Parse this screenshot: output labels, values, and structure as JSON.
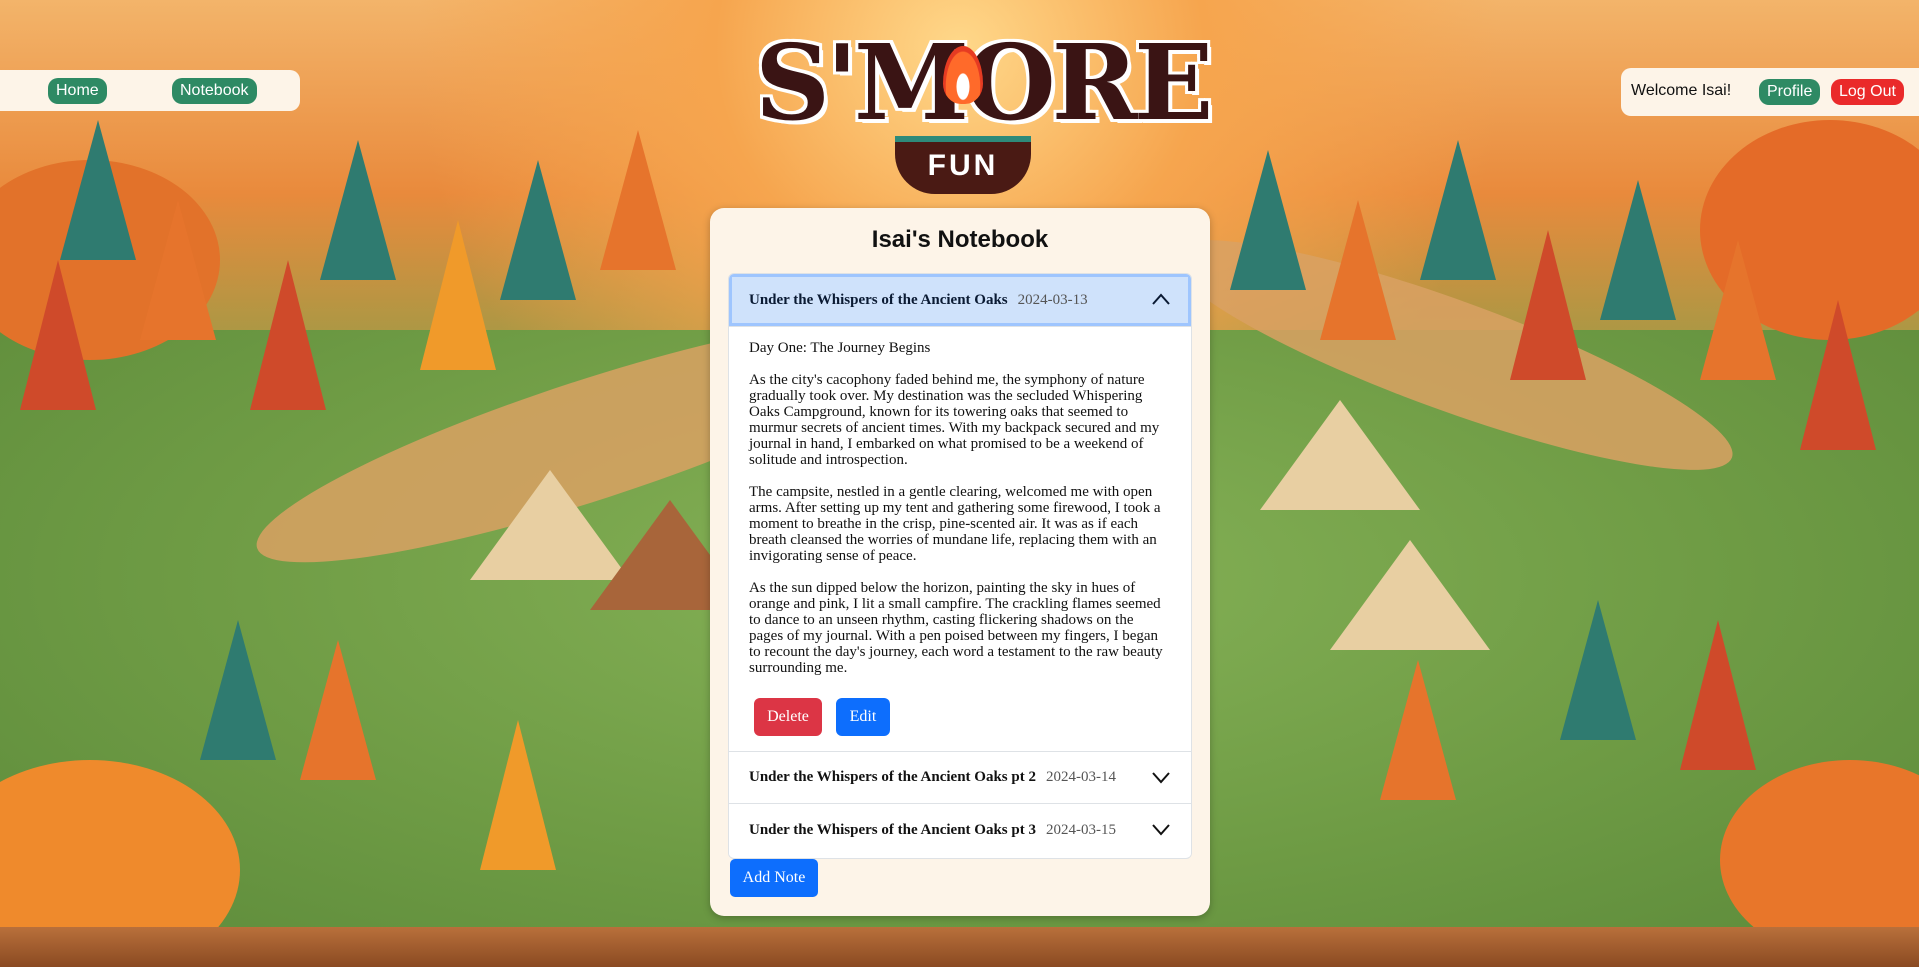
{
  "nav": {
    "home_label": "Home",
    "notebook_label": "Notebook",
    "welcome_text": "Welcome Isai!",
    "profile_label": "Profile",
    "logout_label": "Log Out"
  },
  "logo": {
    "main_text": "S'MORE",
    "sub_text": "FUN"
  },
  "notebook": {
    "title": "Isai's Notebook",
    "notes": [
      {
        "title": "Under the Whispers of the Ancient Oaks",
        "date": "2024-03-13",
        "expanded": true,
        "paragraphs": [
          "Day One: The Journey Begins",
          "As the city's cacophony faded behind me, the symphony of nature gradually took over. My destination was the secluded Whispering Oaks Campground, known for its towering oaks that seemed to murmur secrets of ancient times. With my backpack secured and my journal in hand, I embarked on what promised to be a weekend of solitude and introspection.",
          "The campsite, nestled in a gentle clearing, welcomed me with open arms. After setting up my tent and gathering some firewood, I took a moment to breathe in the crisp, pine-scented air. It was as if each breath cleansed the worries of mundane life, replacing them with an invigorating sense of peace.",
          "As the sun dipped below the horizon, painting the sky in hues of orange and pink, I lit a small campfire. The crackling flames seemed to dance to an unseen rhythm, casting flickering shadows on the pages of my journal. With a pen poised between my fingers, I began to recount the day's journey, each word a testament to the raw beauty surrounding me."
        ]
      },
      {
        "title": "Under the Whispers of the Ancient Oaks pt 2",
        "date": "2024-03-14",
        "expanded": false
      },
      {
        "title": "Under the Whispers of the Ancient Oaks pt 3",
        "date": "2024-03-15",
        "expanded": false
      }
    ],
    "delete_label": "Delete",
    "edit_label": "Edit",
    "add_note_label": "Add Note"
  },
  "colors": {
    "nav_pill": "#2e8a64",
    "logout": "#ea2a2a",
    "primary": "#0d6efd",
    "danger": "#dc3545",
    "active_header": "#cfe2fb"
  }
}
